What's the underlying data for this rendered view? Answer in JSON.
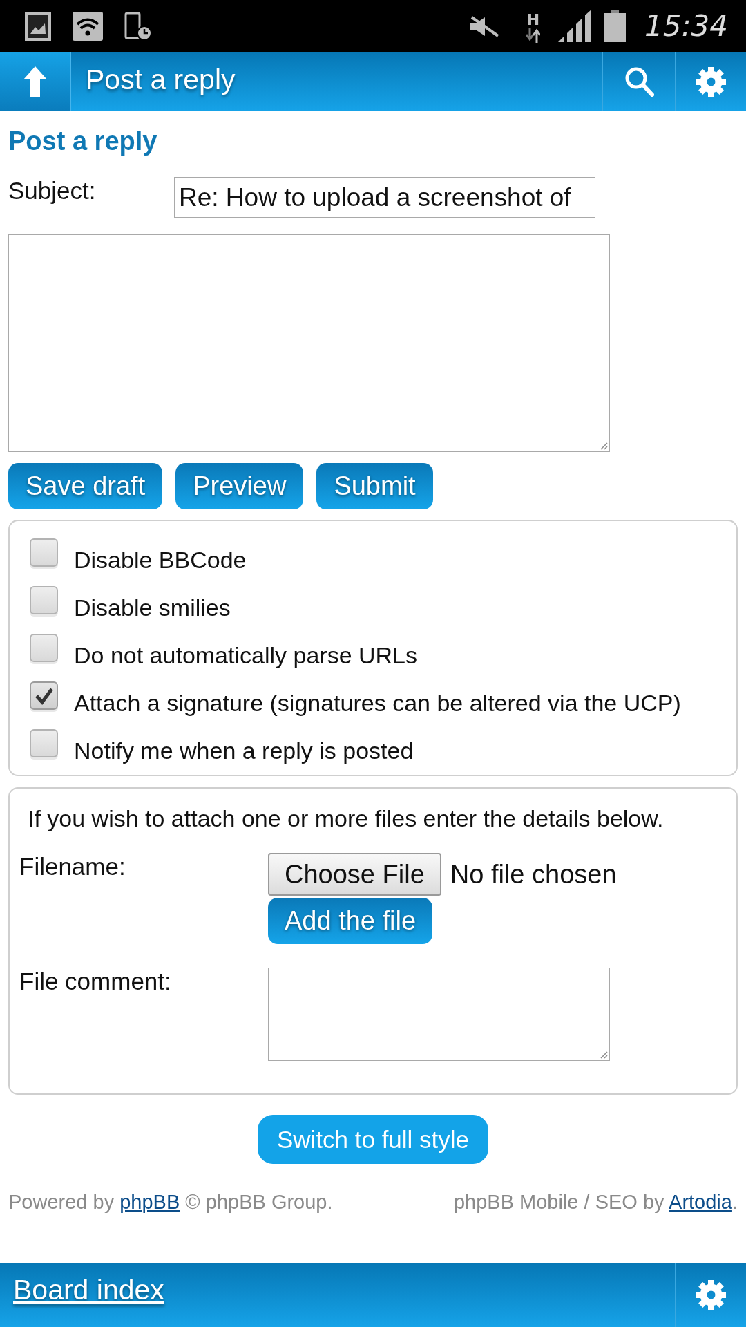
{
  "status_bar": {
    "network_type": "H",
    "time": "15:34"
  },
  "app_bar": {
    "title": "Post a reply"
  },
  "heading": "Post a reply",
  "subject": {
    "label": "Subject:",
    "value": "Re: How to upload a screenshot of"
  },
  "post_buttons": [
    "Save draft",
    "Preview",
    "Submit"
  ],
  "options": [
    {
      "label": "Disable BBCode",
      "checked": false
    },
    {
      "label": "Disable smilies",
      "checked": false
    },
    {
      "label": "Do not automatically parse URLs",
      "checked": false
    },
    {
      "label": "Attach a signature (signatures can be altered via the UCP)",
      "checked": true
    },
    {
      "label": "Notify me when a reply is posted",
      "checked": false
    }
  ],
  "attachment": {
    "intro": "If you wish to attach one or more files enter the details below.",
    "filename_label": "Filename:",
    "choose_button": "Choose File",
    "file_status": "No file chosen",
    "add_button": "Add the file",
    "comment_label": "File comment:"
  },
  "switch_style_button": "Switch to full style",
  "footer": {
    "left": {
      "before": "Powered by ",
      "link": "phpBB",
      "after": " © phpBB Group."
    },
    "right": {
      "before": "phpBB Mobile / SEO by ",
      "link": "Artodia",
      "after": "."
    }
  },
  "bottom_bar": {
    "link": "Board index"
  }
}
